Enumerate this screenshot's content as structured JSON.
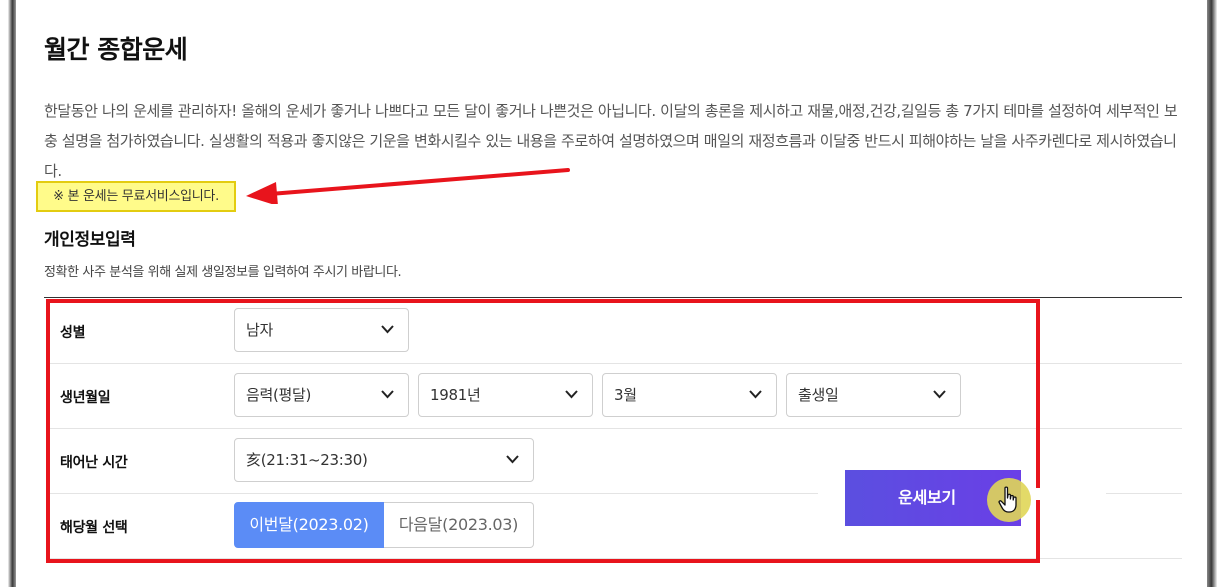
{
  "page": {
    "title": "월간 종합운세",
    "description": "한달동안 나의 운세를 관리하자! 올해의 운세가 좋거나 나쁘다고 모든 달이 좋거나 나쁜것은 아닙니다. 이달의 총론을 제시하고 재물,애정,건강,길일등 총 7가지 테마를 설정하여 세부적인 보충 설명을 첨가하였습니다. 실생활의 적용과 좋지않은 기운을 변화시킬수 있는 내용을 주로하여 설명하였으며 매일의 재정흐름과 이달중 반드시 피해야하는 날을 사주카렌다로 제시하였습니다.",
    "free_note": "※ 본 운세는 무료서비스입니다."
  },
  "section": {
    "title": "개인정보입력",
    "subtitle": "정확한 사주 분석을 위해 실제 생일정보를 입력하여 주시기 바랍니다."
  },
  "form": {
    "gender": {
      "label": "성별",
      "value": "남자"
    },
    "birthdate": {
      "label": "생년월일",
      "calendar": "음력(평달)",
      "year": "1981년",
      "month": "3월",
      "day": "출생일"
    },
    "birth_time": {
      "label": "태어난 시간",
      "value": "亥(21:31~23:30)"
    },
    "target_month": {
      "label": "해당월 선택",
      "options": [
        "이번달(2023.02)",
        "다음달(2023.03)"
      ],
      "selected_index": 0
    }
  },
  "submit": {
    "label": "운세보기"
  },
  "colors": {
    "annotation_red": "#e8141c",
    "highlight_yellow": "#fffb8a",
    "active_blue": "#5b8cf6",
    "button_purple": "#5b4fe0"
  },
  "icons": {
    "select": "chevron-down-icon",
    "cursor": "hand-pointer-icon"
  }
}
